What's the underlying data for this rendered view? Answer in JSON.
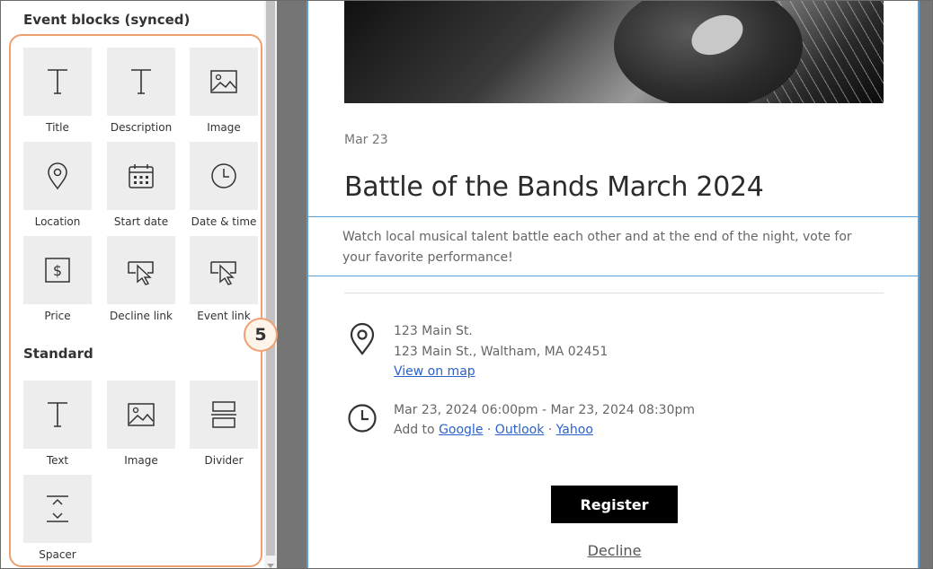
{
  "panel": {
    "event_blocks_title": "Event blocks (synced)",
    "standard_title": "Standard",
    "badge_number": "5",
    "event_blocks": [
      {
        "label": "Title",
        "icon": "text-t-icon"
      },
      {
        "label": "Description",
        "icon": "text-t-icon"
      },
      {
        "label": "Image",
        "icon": "image-icon"
      },
      {
        "label": "Location",
        "icon": "location-pin-icon"
      },
      {
        "label": "Start date",
        "icon": "calendar-icon"
      },
      {
        "label": "Date & time",
        "icon": "clock-icon"
      },
      {
        "label": "Price",
        "icon": "dollar-icon"
      },
      {
        "label": "Decline link",
        "icon": "cursor-click-icon"
      },
      {
        "label": "Event link",
        "icon": "cursor-click-icon"
      }
    ],
    "standard_blocks": [
      {
        "label": "Text",
        "icon": "text-t-icon"
      },
      {
        "label": "Image",
        "icon": "image-icon"
      },
      {
        "label": "Divider",
        "icon": "divider-icon"
      },
      {
        "label": "Spacer",
        "icon": "spacer-icon"
      }
    ]
  },
  "email": {
    "date_short": "Mar 23",
    "title": "Battle of the Bands March 2024",
    "description": "Watch local musical talent battle each other and at the end of the night, vote for your favorite performance!",
    "location_name": "123 Main St.",
    "location_address": "123 Main St., Waltham, MA 02451",
    "view_on_map": "View on map",
    "datetime": "Mar 23, 2024 06:00pm - Mar 23, 2024 08:30pm",
    "add_to": "Add to",
    "calendar_google": "Google",
    "calendar_outlook": "Outlook",
    "calendar_yahoo": "Yahoo",
    "separator": "·",
    "register_label": "Register",
    "decline_label": "Decline"
  },
  "colors": {
    "highlight": "#f0a070",
    "link": "#2a62c9",
    "selection_border": "#5aa0d8",
    "canvas_gray": "#757575",
    "button_bg": "#000000"
  }
}
